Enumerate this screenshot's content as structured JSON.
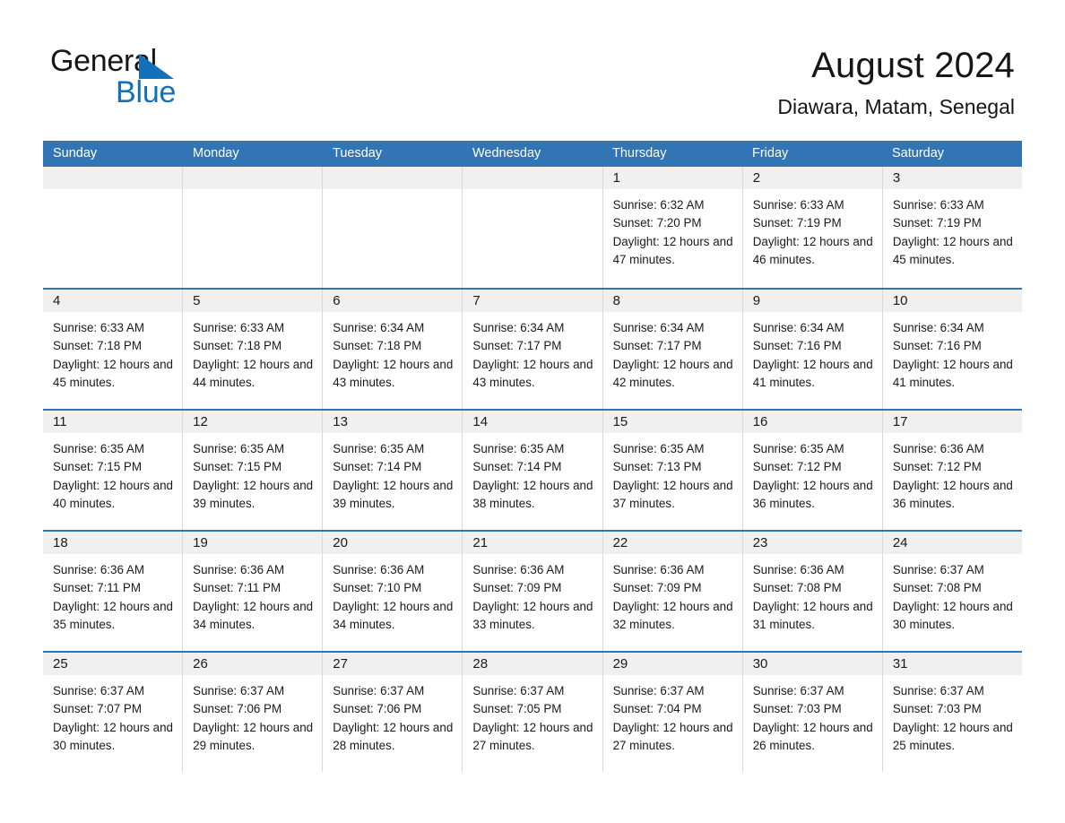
{
  "brand": {
    "name_part1": "General",
    "name_part2": "Blue",
    "triangle_icon": "triangle-icon",
    "accent_color": "#1470b8"
  },
  "header": {
    "title": "August 2024",
    "subtitle": "Diawara, Matam, Senegal"
  },
  "calendar": {
    "header_color": "#3275b4",
    "daynum_band_color": "#f0f0f0",
    "weekdays": [
      "Sunday",
      "Monday",
      "Tuesday",
      "Wednesday",
      "Thursday",
      "Friday",
      "Saturday"
    ],
    "weeks": [
      [
        {
          "day": "",
          "sunrise": "",
          "sunset": "",
          "daylight": "",
          "empty": true
        },
        {
          "day": "",
          "sunrise": "",
          "sunset": "",
          "daylight": "",
          "empty": true
        },
        {
          "day": "",
          "sunrise": "",
          "sunset": "",
          "daylight": "",
          "empty": true
        },
        {
          "day": "",
          "sunrise": "",
          "sunset": "",
          "daylight": "",
          "empty": true
        },
        {
          "day": "1",
          "sunrise": "Sunrise: 6:32 AM",
          "sunset": "Sunset: 7:20 PM",
          "daylight": "Daylight: 12 hours and 47 minutes."
        },
        {
          "day": "2",
          "sunrise": "Sunrise: 6:33 AM",
          "sunset": "Sunset: 7:19 PM",
          "daylight": "Daylight: 12 hours and 46 minutes."
        },
        {
          "day": "3",
          "sunrise": "Sunrise: 6:33 AM",
          "sunset": "Sunset: 7:19 PM",
          "daylight": "Daylight: 12 hours and 45 minutes."
        }
      ],
      [
        {
          "day": "4",
          "sunrise": "Sunrise: 6:33 AM",
          "sunset": "Sunset: 7:18 PM",
          "daylight": "Daylight: 12 hours and 45 minutes."
        },
        {
          "day": "5",
          "sunrise": "Sunrise: 6:33 AM",
          "sunset": "Sunset: 7:18 PM",
          "daylight": "Daylight: 12 hours and 44 minutes."
        },
        {
          "day": "6",
          "sunrise": "Sunrise: 6:34 AM",
          "sunset": "Sunset: 7:18 PM",
          "daylight": "Daylight: 12 hours and 43 minutes."
        },
        {
          "day": "7",
          "sunrise": "Sunrise: 6:34 AM",
          "sunset": "Sunset: 7:17 PM",
          "daylight": "Daylight: 12 hours and 43 minutes."
        },
        {
          "day": "8",
          "sunrise": "Sunrise: 6:34 AM",
          "sunset": "Sunset: 7:17 PM",
          "daylight": "Daylight: 12 hours and 42 minutes."
        },
        {
          "day": "9",
          "sunrise": "Sunrise: 6:34 AM",
          "sunset": "Sunset: 7:16 PM",
          "daylight": "Daylight: 12 hours and 41 minutes."
        },
        {
          "day": "10",
          "sunrise": "Sunrise: 6:34 AM",
          "sunset": "Sunset: 7:16 PM",
          "daylight": "Daylight: 12 hours and 41 minutes."
        }
      ],
      [
        {
          "day": "11",
          "sunrise": "Sunrise: 6:35 AM",
          "sunset": "Sunset: 7:15 PM",
          "daylight": "Daylight: 12 hours and 40 minutes."
        },
        {
          "day": "12",
          "sunrise": "Sunrise: 6:35 AM",
          "sunset": "Sunset: 7:15 PM",
          "daylight": "Daylight: 12 hours and 39 minutes."
        },
        {
          "day": "13",
          "sunrise": "Sunrise: 6:35 AM",
          "sunset": "Sunset: 7:14 PM",
          "daylight": "Daylight: 12 hours and 39 minutes."
        },
        {
          "day": "14",
          "sunrise": "Sunrise: 6:35 AM",
          "sunset": "Sunset: 7:14 PM",
          "daylight": "Daylight: 12 hours and 38 minutes."
        },
        {
          "day": "15",
          "sunrise": "Sunrise: 6:35 AM",
          "sunset": "Sunset: 7:13 PM",
          "daylight": "Daylight: 12 hours and 37 minutes."
        },
        {
          "day": "16",
          "sunrise": "Sunrise: 6:35 AM",
          "sunset": "Sunset: 7:12 PM",
          "daylight": "Daylight: 12 hours and 36 minutes."
        },
        {
          "day": "17",
          "sunrise": "Sunrise: 6:36 AM",
          "sunset": "Sunset: 7:12 PM",
          "daylight": "Daylight: 12 hours and 36 minutes."
        }
      ],
      [
        {
          "day": "18",
          "sunrise": "Sunrise: 6:36 AM",
          "sunset": "Sunset: 7:11 PM",
          "daylight": "Daylight: 12 hours and 35 minutes."
        },
        {
          "day": "19",
          "sunrise": "Sunrise: 6:36 AM",
          "sunset": "Sunset: 7:11 PM",
          "daylight": "Daylight: 12 hours and 34 minutes."
        },
        {
          "day": "20",
          "sunrise": "Sunrise: 6:36 AM",
          "sunset": "Sunset: 7:10 PM",
          "daylight": "Daylight: 12 hours and 34 minutes."
        },
        {
          "day": "21",
          "sunrise": "Sunrise: 6:36 AM",
          "sunset": "Sunset: 7:09 PM",
          "daylight": "Daylight: 12 hours and 33 minutes."
        },
        {
          "day": "22",
          "sunrise": "Sunrise: 6:36 AM",
          "sunset": "Sunset: 7:09 PM",
          "daylight": "Daylight: 12 hours and 32 minutes."
        },
        {
          "day": "23",
          "sunrise": "Sunrise: 6:36 AM",
          "sunset": "Sunset: 7:08 PM",
          "daylight": "Daylight: 12 hours and 31 minutes."
        },
        {
          "day": "24",
          "sunrise": "Sunrise: 6:37 AM",
          "sunset": "Sunset: 7:08 PM",
          "daylight": "Daylight: 12 hours and 30 minutes."
        }
      ],
      [
        {
          "day": "25",
          "sunrise": "Sunrise: 6:37 AM",
          "sunset": "Sunset: 7:07 PM",
          "daylight": "Daylight: 12 hours and 30 minutes."
        },
        {
          "day": "26",
          "sunrise": "Sunrise: 6:37 AM",
          "sunset": "Sunset: 7:06 PM",
          "daylight": "Daylight: 12 hours and 29 minutes."
        },
        {
          "day": "27",
          "sunrise": "Sunrise: 6:37 AM",
          "sunset": "Sunset: 7:06 PM",
          "daylight": "Daylight: 12 hours and 28 minutes."
        },
        {
          "day": "28",
          "sunrise": "Sunrise: 6:37 AM",
          "sunset": "Sunset: 7:05 PM",
          "daylight": "Daylight: 12 hours and 27 minutes."
        },
        {
          "day": "29",
          "sunrise": "Sunrise: 6:37 AM",
          "sunset": "Sunset: 7:04 PM",
          "daylight": "Daylight: 12 hours and 27 minutes."
        },
        {
          "day": "30",
          "sunrise": "Sunrise: 6:37 AM",
          "sunset": "Sunset: 7:03 PM",
          "daylight": "Daylight: 12 hours and 26 minutes."
        },
        {
          "day": "31",
          "sunrise": "Sunrise: 6:37 AM",
          "sunset": "Sunset: 7:03 PM",
          "daylight": "Daylight: 12 hours and 25 minutes."
        }
      ]
    ]
  }
}
